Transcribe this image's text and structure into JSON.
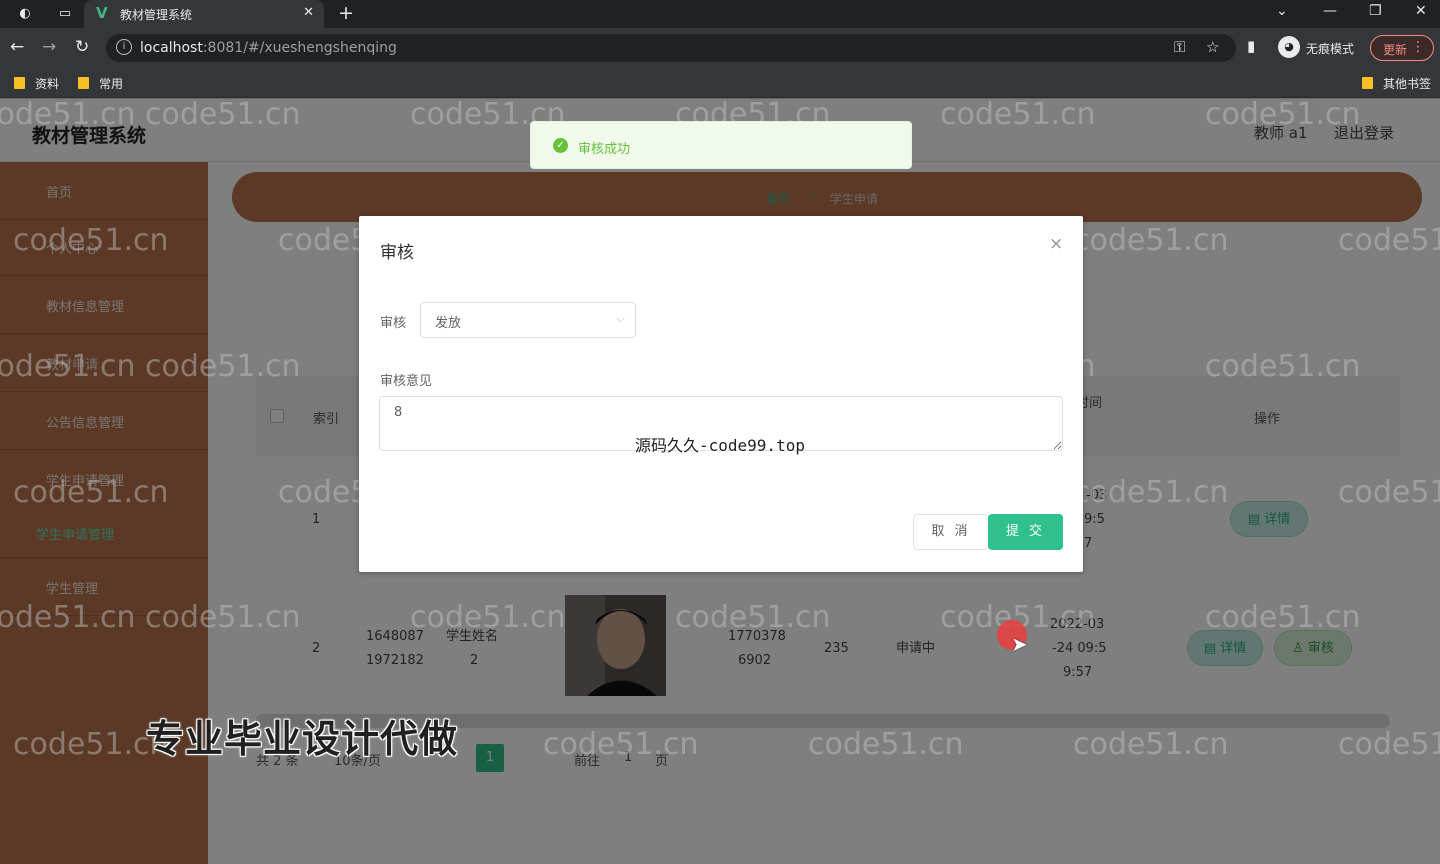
{
  "browser": {
    "tab_title": "教材管理系统",
    "url_host": "localhost",
    "url_rest": ":8081/#/xueshengshenqing",
    "incognito_label": "无痕模式",
    "update_label": "更新",
    "bookmarks": [
      "资料",
      "常用"
    ],
    "other_bookmarks": "其他书签"
  },
  "app": {
    "title": "教材管理系统",
    "user": "教师 a1",
    "logout": "退出登录"
  },
  "sidebar": {
    "items": [
      "首页",
      "个人中心",
      "教材信息管理",
      "教材申请",
      "公告信息管理",
      "学生申请管理",
      "学生管理"
    ],
    "sub_item": "学生申请管理"
  },
  "breadcrumb": {
    "home": "首页",
    "current": "学生申请"
  },
  "table": {
    "headers": {
      "index": "索引",
      "time": "时间",
      "ops": "操作"
    },
    "row1": {
      "index": "1",
      "date_a": "-03",
      "date_b": "9:5",
      "date_c": "7",
      "detail": "详情"
    },
    "row2": {
      "index": "2",
      "num_a": "1648087",
      "num_b": "1972182",
      "name_a": "学生姓名",
      "name_b": "2",
      "phone_a": "1770378",
      "phone_b": "6902",
      "qty": "235",
      "status": "申请中",
      "time_a": "2022-03",
      "time_b": "-24 09:5",
      "time_c": "9:57",
      "detail": "详情",
      "audit": "审核"
    }
  },
  "pager": {
    "total": "共 2 条",
    "per_page": "10条/页",
    "current": "1",
    "goto": "前往",
    "goto_value": "1",
    "page_suffix": "页"
  },
  "toast": {
    "message": "审核成功"
  },
  "dialog": {
    "title": "审核",
    "audit_label": "审核",
    "audit_value": "发放",
    "opinion_label": "审核意见",
    "opinion_value": "8",
    "cancel": "取 消",
    "submit": "提 交"
  },
  "watermarks": {
    "site": "code51.cn",
    "center_text": "源码久久-code99.top",
    "promo": "专业毕业设计代做"
  }
}
